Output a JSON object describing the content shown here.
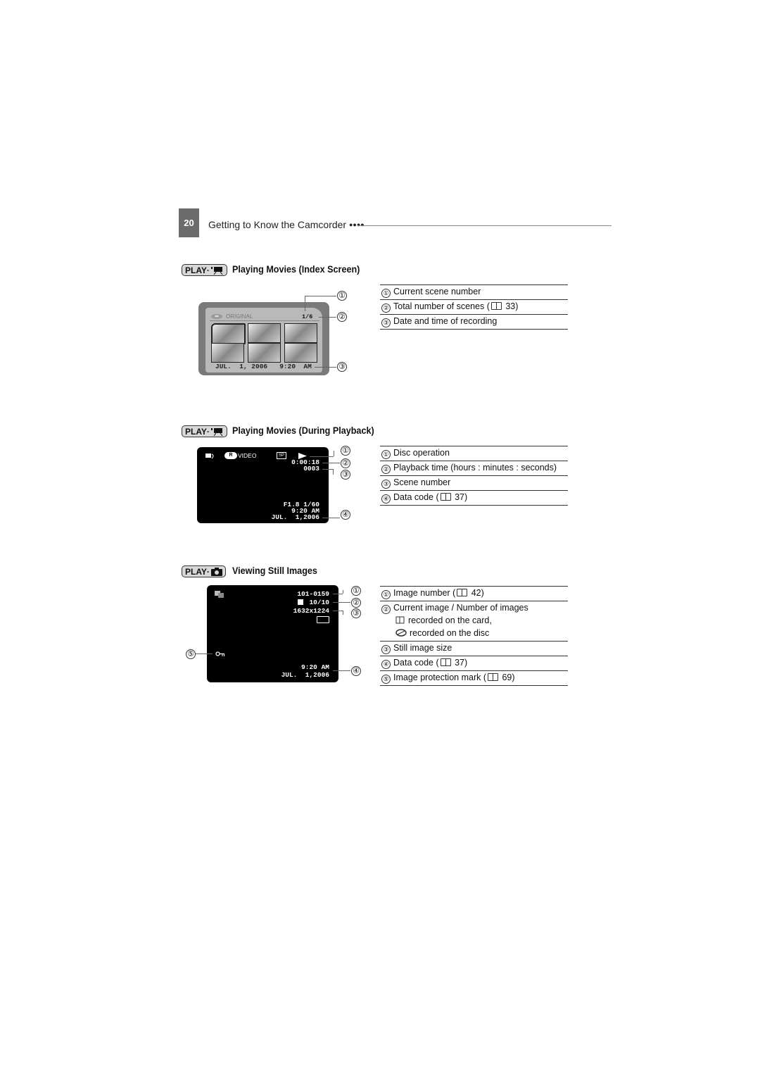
{
  "header": {
    "page_number": "20",
    "chapter_title": "Getting to Know the Camcorder",
    "chapter_dots": "●●●●"
  },
  "sections": [
    {
      "mode_badge": {
        "text": "PLAY·",
        "icon": "movie-camera-icon"
      },
      "title": "Playing Movies (Index Screen)",
      "screen": {
        "label": "ORIGINAL",
        "count": "1/6",
        "date": "JUL.  1, 2006   9:20  AM",
        "thumbnails": 6
      },
      "callouts": [
        "①",
        "②",
        "③"
      ],
      "legend": [
        {
          "num": "①",
          "text": "Current scene number"
        },
        {
          "num": "②",
          "text": "Total number of scenes (",
          "ref": "33)"
        },
        {
          "num": "③",
          "text": "Date and time of recording"
        }
      ]
    },
    {
      "mode_badge": {
        "text": "PLAY·",
        "icon": "movie-camera-icon"
      },
      "title": "Playing Movies (During Playback)",
      "screen": {
        "disc_label": "VIDEO",
        "disc_badge": "R",
        "sp_label": "SP",
        "time": "0:00:18",
        "scene": "0003",
        "exposure": "F1.8 1/60",
        "clock": "9:20 AM",
        "date": "JUL.  1,2006"
      },
      "callouts": [
        "①",
        "②",
        "③",
        "④"
      ],
      "legend": [
        {
          "num": "①",
          "text": "Disc operation"
        },
        {
          "num": "②",
          "text": "Playback time (hours : minutes : seconds)"
        },
        {
          "num": "③",
          "text": "Scene number"
        },
        {
          "num": "④",
          "text": "Data code (",
          "ref": "37)"
        }
      ]
    },
    {
      "mode_badge": {
        "text": "PLAY·",
        "icon": "camera-icon"
      },
      "title": "Viewing Still Images",
      "screen": {
        "image_number": "101-0159",
        "image_count": "10/10",
        "image_size": "1632x1224",
        "clock": "9:20 AM",
        "date": "JUL.  1,2006"
      },
      "callouts": [
        "①",
        "②",
        "③",
        "④",
        "⑤"
      ],
      "legend": [
        {
          "num": "①",
          "text": "Image number (",
          "ref": "42)"
        },
        {
          "num": "②",
          "text": "Current image / Number of images"
        },
        {
          "sub": "recorded on the card,",
          "icon": "card-icon"
        },
        {
          "sub": "recorded on the disc",
          "icon": "disc-icon"
        },
        {
          "num": "③",
          "text": "Still image size"
        },
        {
          "num": "④",
          "text": "Data code (",
          "ref": "37)"
        },
        {
          "num": "⑤",
          "text": "Image protection mark (",
          "ref": "69)"
        }
      ]
    }
  ]
}
